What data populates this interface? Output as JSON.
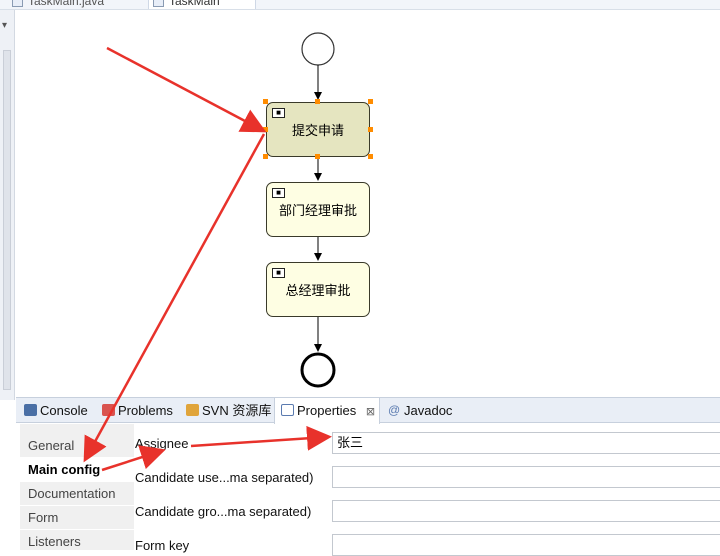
{
  "editor_tabs": [
    {
      "label": "TaskMain.java"
    },
    {
      "label": "TaskMain"
    }
  ],
  "diagram": {
    "tasks": [
      {
        "label": "提交申请"
      },
      {
        "label": "部门经理审批"
      },
      {
        "label": "总经理审批"
      }
    ]
  },
  "views": {
    "tabs": [
      {
        "label": "Console"
      },
      {
        "label": "Problems"
      },
      {
        "label": "SVN 资源库"
      },
      {
        "label": "Properties"
      },
      {
        "label": "Javadoc"
      }
    ],
    "close_glyph": "⊠"
  },
  "properties": {
    "sections": [
      "General",
      "Main config",
      "Documentation",
      "Form",
      "Listeners"
    ],
    "fields": [
      {
        "label": "Assignee",
        "value": "张三"
      },
      {
        "label": "Candidate use...ma separated)",
        "value": ""
      },
      {
        "label": "Candidate gro...ma separated)",
        "value": ""
      },
      {
        "label": "Form key",
        "value": ""
      }
    ]
  },
  "colors": {
    "annotation_arrow": "#e8322b",
    "selection_handle": "#ff8c00",
    "selected_task_fill": "#e5e5c0",
    "task_fill": "#fefee3"
  }
}
